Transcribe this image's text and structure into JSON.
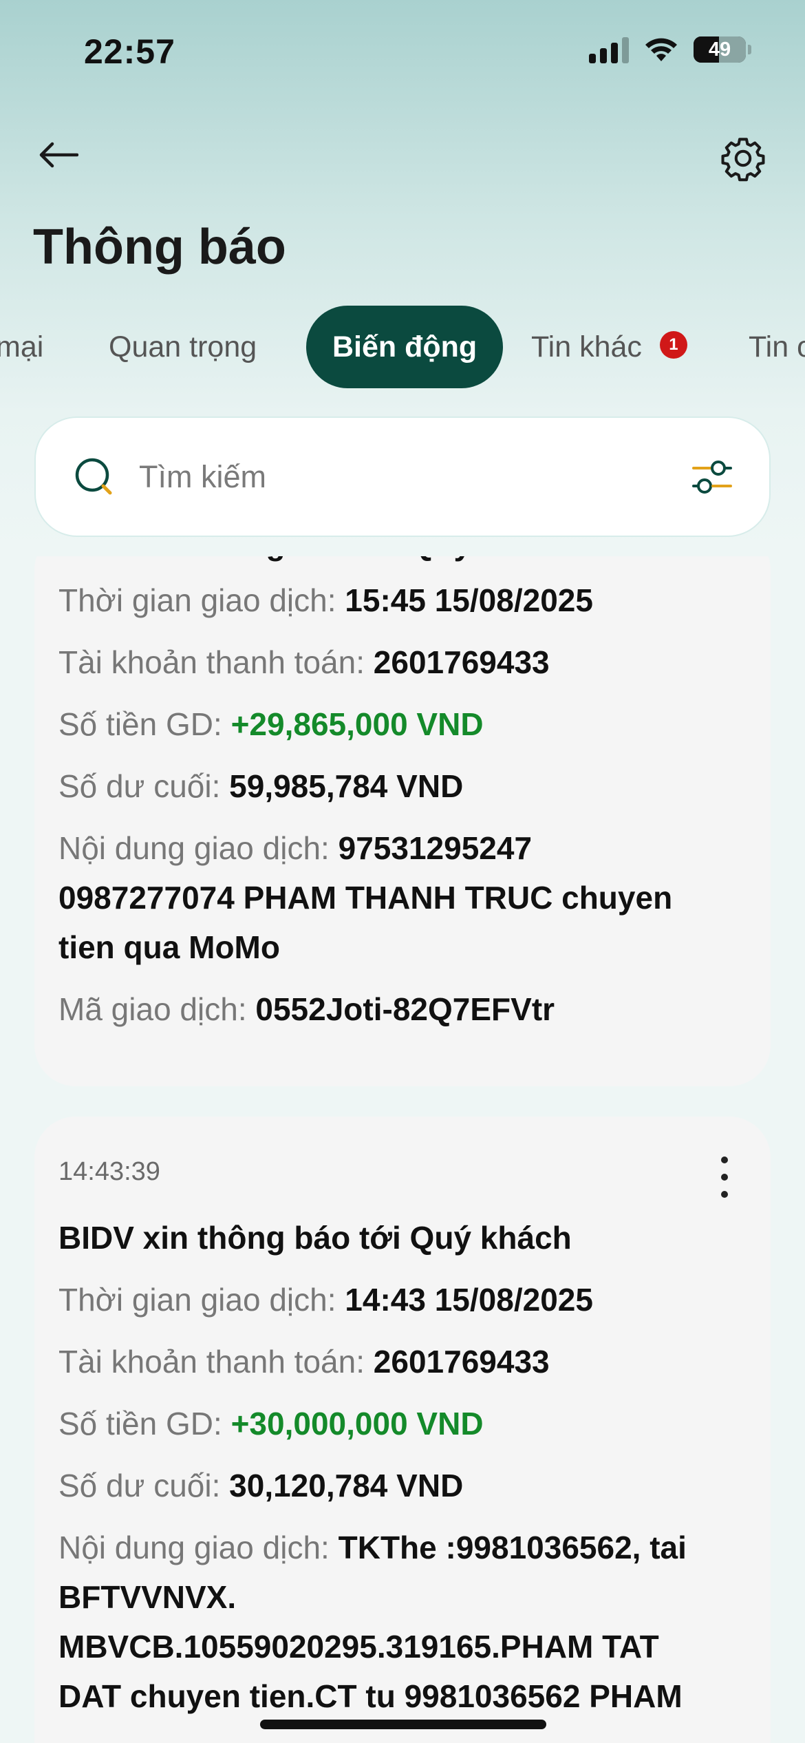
{
  "status_bar": {
    "time": "22:57",
    "battery": "49"
  },
  "header": {
    "title": "Thông báo"
  },
  "tabs": [
    {
      "label": "mại"
    },
    {
      "label": "Quan trọng"
    },
    {
      "label": "Biến động"
    },
    {
      "label": "Tin khác",
      "badge": "1"
    },
    {
      "label": "Tin ơ"
    }
  ],
  "search": {
    "placeholder": "Tìm kiếm"
  },
  "notifications": [
    {
      "heading_partial": "BIDV xin thông báo tới Quý khách",
      "time_label": "Thời gian giao dịch: ",
      "time_value": "15:45 15/08/2025",
      "account_label": "Tài khoản thanh toán: ",
      "account_value": "2601769433",
      "amount_label": "Số tiền GD: ",
      "amount_value": "+29,865,000 VND",
      "balance_label": "Số dư cuối: ",
      "balance_value": "59,985,784 VND",
      "content_label": "Nội dung giao dịch: ",
      "content_value_1": "97531295247",
      "content_value_2": "0987277074 PHAM THANH TRUC chuyen",
      "content_value_3": "tien qua MoMo",
      "code_label": "Mã giao dịch: ",
      "code_value": "0552Joti-82Q7EFVtr"
    },
    {
      "timestamp": "14:43:39",
      "heading": "BIDV xin thông báo tới Quý khách",
      "time_label": "Thời gian giao dịch: ",
      "time_value": "14:43 15/08/2025",
      "account_label": "Tài khoản thanh toán: ",
      "account_value": "2601769433",
      "amount_label": "Số tiền GD: ",
      "amount_value": "+30,000,000 VND",
      "balance_label": "Số dư cuối: ",
      "balance_value": "30,120,784 VND",
      "content_label": "Nội dung giao dịch: ",
      "content_value_1": "TKThe :9981036562, tai",
      "content_value_2": "BFTVVNVX.",
      "content_value_3": "MBVCB.10559020295.319165.PHAM TAT",
      "content_value_4": "DAT chuyen tien.CT tu 9981036562 PHAM"
    }
  ],
  "colors": {
    "accent": "#0b4a3f",
    "positive": "#148a2a",
    "badge": "#d01818"
  }
}
